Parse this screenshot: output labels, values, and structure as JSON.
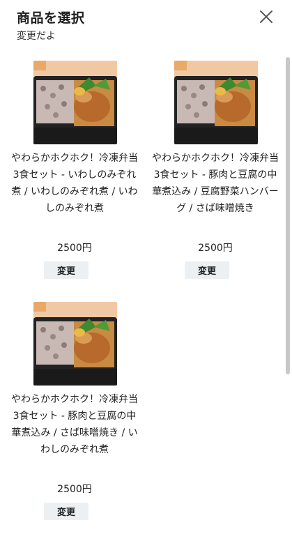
{
  "header": {
    "title": "商品を選択",
    "subtitle": "変更だよ",
    "close_icon": "close-icon"
  },
  "products": [
    {
      "name": "やわらかホクホク！冷凍弁当3食セット - いわしのみぞれ煮 / いわしのみぞれ煮 / いわしのみぞれ煮",
      "price": "2500円",
      "button": "変更"
    },
    {
      "name": "やわらかホクホク！冷凍弁当3食セット - 豚肉と豆腐の中華煮込み / 豆腐野菜ハンバーグ / さば味噌焼き",
      "price": "2500円",
      "button": "変更"
    },
    {
      "name": "やわらかホクホク！冷凍弁当3食セット - 豚肉と豆腐の中華煮込み / さば味噌焼き / いわしのみぞれ煮",
      "price": "2500円",
      "button": "変更"
    }
  ],
  "colors": {
    "button_bg": "#edf0f3",
    "scrollbar": "#c8c8c8"
  }
}
